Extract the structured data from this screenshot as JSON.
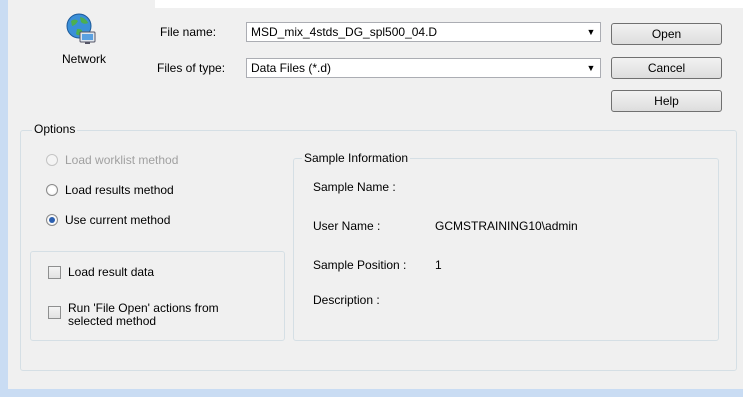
{
  "network": {
    "label": "Network",
    "icon": "network-globe-icon"
  },
  "file_name": {
    "label": "File name:",
    "value": "MSD_mix_4stds_DG_spl500_04.D"
  },
  "files_of_type": {
    "label": "Files of type:",
    "value": "Data Files (*.d)"
  },
  "buttons": {
    "open": "Open",
    "cancel": "Cancel",
    "help": "Help"
  },
  "options": {
    "title": "Options",
    "radios": [
      {
        "label": "Load worklist method",
        "checked": false,
        "disabled": true
      },
      {
        "label": "Load results method",
        "checked": false,
        "disabled": false
      },
      {
        "label": "Use current method",
        "checked": true,
        "disabled": false
      }
    ],
    "checkboxes": [
      {
        "label": "Load result data",
        "checked": false
      },
      {
        "label_line1": "Run 'File Open' actions from",
        "label_line2": "selected method",
        "checked": false
      }
    ]
  },
  "sample_info": {
    "title": "Sample Information",
    "sample_name_label": "Sample Name :",
    "sample_name_value": "",
    "user_name_label": "User Name :",
    "user_name_value": "GCMSTRAINING10\\admin",
    "sample_position_label": "Sample Position :",
    "sample_position_value": "1",
    "description_label": "Description :",
    "description_value": ""
  },
  "colors": {
    "frame": "#c9dcf3",
    "dialog_bg": "#f0f0f0",
    "radio_dot": "#2b5fb0"
  }
}
